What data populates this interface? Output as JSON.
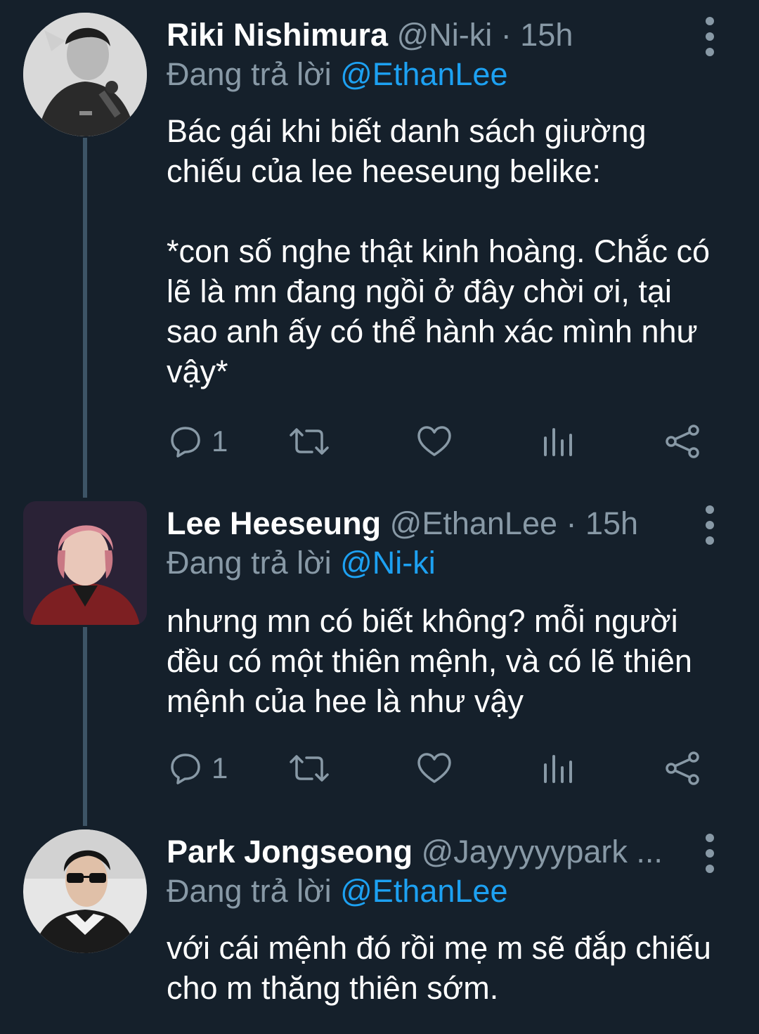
{
  "colors": {
    "background": "#15202b",
    "text": "#ffffff",
    "secondary": "#8899a6",
    "link": "#1da1f2",
    "thread_line": "#3d5466"
  },
  "tweets": [
    {
      "name": "Riki Nishimura",
      "handle": "@Ni-ki",
      "time": "· 15h",
      "replying_label": "Đang trả lời",
      "replying_to": "@EthanLee",
      "body": [
        "Bác gái khi biết danh sách giường chiếu của lee heeseung belike:",
        "*con số nghe thật kinh hoàng. Chắc có lẽ là mn đang ngồi ở đây chời ơi, tại sao anh ấy có thể hành xác mình như vậy*"
      ],
      "reply_count": "1",
      "avatar_icon": "avatar-photo"
    },
    {
      "name": "Lee Heeseung",
      "handle": "@EthanLee",
      "time": "· 15h",
      "replying_label": "Đang trả lời",
      "replying_to": "@Ni-ki",
      "body": [
        "nhưng mn có biết không? mỗi người đều có một thiên mệnh, và có lẽ thiên mệnh của hee là như vậy"
      ],
      "reply_count": "1",
      "avatar_icon": "avatar-photo"
    },
    {
      "name": "Park Jongseong",
      "handle": "@Jayyyyypark ...",
      "time": "",
      "replying_label": "Đang trả lời",
      "replying_to": "@EthanLee",
      "body": [
        "với cái mệnh đó rồi mẹ m sẽ đắp chiếu cho m thăng thiên sớm."
      ],
      "avatar_icon": "avatar-photo"
    }
  ],
  "action_icons": [
    "reply-icon",
    "retweet-icon",
    "like-icon",
    "analytics-icon",
    "share-icon"
  ]
}
